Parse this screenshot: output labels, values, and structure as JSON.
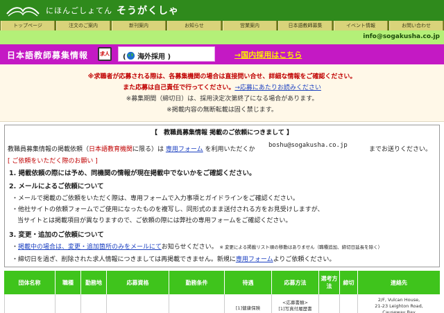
{
  "header": {
    "logo_small": "にほんごしょてん",
    "logo_big": "そうがくしゃ"
  },
  "nav": {
    "items": [
      "トップページ",
      "注文のご案内",
      "新刊案内",
      "お知らせ",
      "営業案内",
      "日本語教師募集",
      "イベント情報",
      "お問い合わせ"
    ]
  },
  "info": {
    "email": "info@sogakusha.co.jp"
  },
  "title_bar": {
    "title": "日本語教師募集情報",
    "badge": "求人",
    "overseas": "海外採用",
    "domestic_link": "→国内採用はこちら"
  },
  "notice": {
    "line1": "※求職者が応募される際は、各募集機関の場合は直接問い合せ、詳細な情報をご確認ください。",
    "line2_prefix": "また応募は自己責任で行ってください。",
    "line2_link": "→応募にあたりお読みください",
    "line3": "※募集期間（締切日）は、採用決定次第終了になる場合があります。",
    "line4": "※掲載内容の無断転載は固く禁じます。"
  },
  "request": {
    "title": "【　教職員募集情報 掲載のご依頼につきまして 】",
    "intro_1": "教職員募集情報の掲載依頼（",
    "intro_red": "日本語教育機関",
    "intro_2": "に限る）は",
    "form_link": "専用フォーム",
    "intro_3": "を利用いただくか",
    "email": "boshu@sogakusha.co.jp",
    "intro_4": "までお送りください。",
    "section_red": "[ ご依頼をいただく際のお願い ]",
    "item1": "1. 掲載依頼の際には予め、同機関の情報が現在掲載中でないかをご確認ください。",
    "item2": "2. メールによるご依頼について",
    "item2_a": "・メールで掲載のご依頼をいただく際は、専用フォームで入力事項とガイドラインをご確認ください。",
    "item2_b": "・他社サイトの依頼フォームでご使用になったものを複写し、同形式のまま送付される方をお見受けしますが、",
    "item2_c": "当サイトとは掲載項目が異なりますので、ご依頼の際には弊社の専用フォームをご確認ください。",
    "item3": "3. 変更・追加のご依頼について",
    "item3_a_link": "掲載中の場合は、変更・追加箇所のみをメールにて",
    "item3_a_rest": "お知らせください。",
    "item3_a_note": "※ 変更による掲載リスト順の移動はありません（職種追加、締切日延長を除く）",
    "item3_b_1": "・締切日を過ぎ、削除された求人情報につきましては再掲載できません。新規に",
    "item3_b_link": "専用フォーム",
    "item3_b_2": "よりご依頼ください。"
  },
  "table": {
    "headers": [
      "団体名称",
      "職種",
      "勤務地",
      "応募資格",
      "勤務条件",
      "待遇",
      "応募方法",
      "選考方法",
      "締切",
      "連絡先"
    ],
    "row": [
      "",
      "",
      "",
      "",
      "",
      "[1]健康保険",
      "<応募書類>\n[1]写真付履歴書",
      "",
      "",
      "2/F, Vulcan House,\n21-23 Leighton Road,\nCauseway Bay"
    ]
  },
  "colors": {
    "header_green": "#2f8a1c",
    "title_magenta": "#c419c4",
    "table_green": "#3fc41c",
    "warning_red": "#c00000",
    "link_blue": "#1a3fc0"
  }
}
